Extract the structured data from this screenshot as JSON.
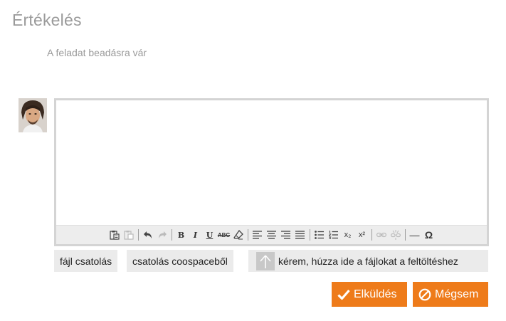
{
  "page": {
    "title": "Értékelés",
    "status": "A feladat beadásra vár"
  },
  "user": {
    "avatar_icon": "user-avatar-photo"
  },
  "editor": {
    "content": "",
    "toolbar": {
      "bold": "B",
      "italic": "I",
      "underline": "U",
      "strikethrough": "ABC",
      "subscript": "x₂",
      "superscript": "x²",
      "horizontal_rule": "—",
      "special_char": "Ω"
    }
  },
  "attachments": {
    "file_attach_label": "fájl csatolás",
    "coospace_attach_label": "csatolás coospaceből",
    "drop_zone_label": "kérem, húzza ide a fájlokat a feltöltéshez"
  },
  "actions": {
    "send_label": "Elküldés",
    "cancel_label": "Mégsem"
  },
  "colors": {
    "accent": "#ee7b1a",
    "muted_text": "#9a9a9a",
    "button_bg": "#ebebeb"
  }
}
